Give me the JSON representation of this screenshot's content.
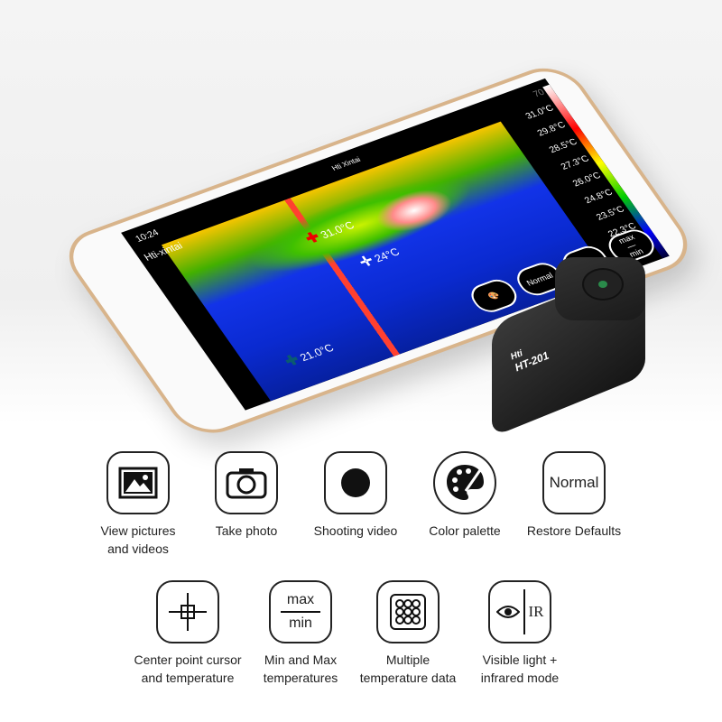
{
  "phone": {
    "status_time": "10:24",
    "battery": "70",
    "app_title": "Hti-xintai",
    "logo_text": "Hti Xintai",
    "scale_labels": [
      "31.0°C",
      "29.8°C",
      "28.5°C",
      "27.3°C",
      "26.0°C",
      "24.8°C",
      "23.5°C",
      "22.3°C"
    ],
    "cursors": {
      "max": "31.0°C",
      "center": "24°C",
      "min": "21.0°C"
    },
    "buttons": {
      "mode": "Normal",
      "max": "max",
      "min": "min"
    }
  },
  "device": {
    "brand": "Hti",
    "model": "HT-201"
  },
  "features": [
    {
      "label": "View pictures\nand videos",
      "icon": "picture-icon"
    },
    {
      "label": "Take photo",
      "icon": "camera-icon"
    },
    {
      "label": "Shooting video",
      "icon": "record-icon"
    },
    {
      "label": "Color palette",
      "icon": "palette-icon"
    },
    {
      "label": "Restore Defaults",
      "icon": "normal-icon",
      "icon_text": "Normal"
    },
    {
      "label": "Center point cursor\nand temperature",
      "icon": "crosshair-icon"
    },
    {
      "label": "Min and Max\ntemperatures",
      "icon": "max-min-icon",
      "icon_text_top": "max",
      "icon_text_bottom": "min"
    },
    {
      "label": "Multiple\ntemperature data",
      "icon": "grid-dots-icon"
    },
    {
      "label": "Visible light +\ninfrared mode",
      "icon": "eye-ir-icon",
      "icon_text": "IR"
    }
  ]
}
